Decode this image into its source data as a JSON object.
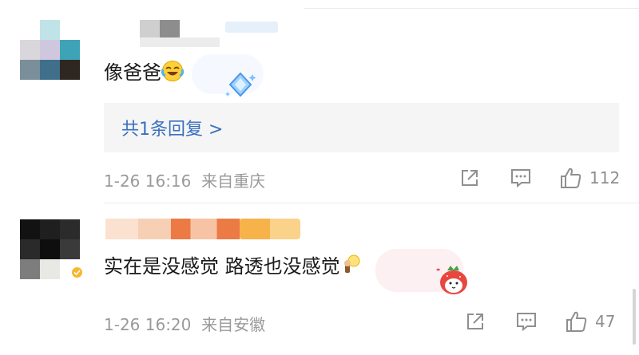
{
  "comments": [
    {
      "text": "像爸爸",
      "reply_link": "共1条回复 >",
      "date": "1-26 16:16",
      "location": "来自重庆",
      "likes": "112"
    },
    {
      "text": "实在是没感觉 路透也没感觉",
      "date": "1-26 16:20",
      "location": "来自安徽",
      "likes": "47"
    }
  ],
  "icons": {
    "share": "share-icon",
    "comment": "comment-icon",
    "like": "thumbs-up-icon"
  },
  "colors": {
    "link": "#3b6fbf",
    "meta": "#9a9a9a",
    "reply_bg": "#f5f5f5",
    "verified": "#f5b82e"
  }
}
